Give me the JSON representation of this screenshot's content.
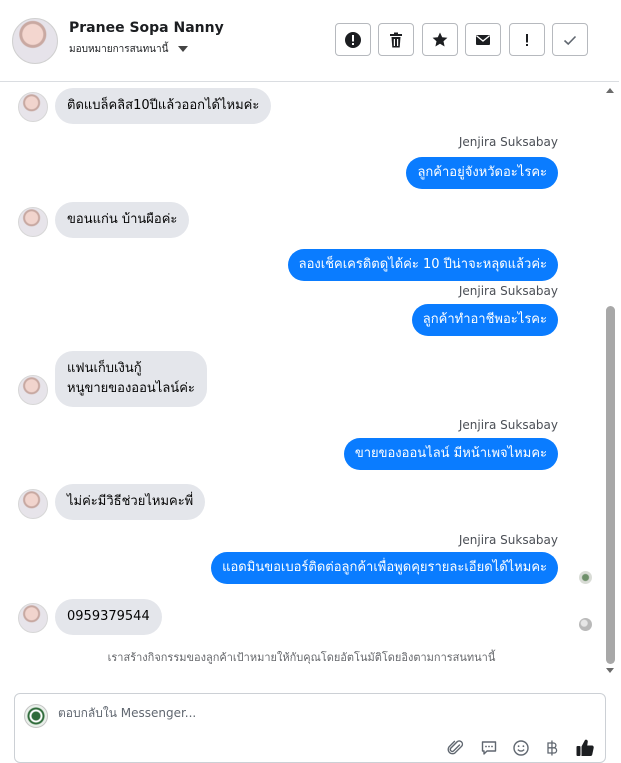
{
  "header": {
    "contact_name": "Pranee Sopa Nanny",
    "assign_label": "มอบหมายการสนทนานี้",
    "actions": [
      {
        "icon": "alert-circle-icon",
        "name": "mark-spam-button"
      },
      {
        "icon": "trash-icon",
        "name": "delete-button"
      },
      {
        "icon": "star-icon",
        "name": "star-button"
      },
      {
        "icon": "envelope-icon",
        "name": "mark-unread-button"
      },
      {
        "icon": "exclamation-icon",
        "name": "follow-up-button"
      },
      {
        "icon": "check-icon",
        "name": "mark-done-button"
      }
    ]
  },
  "thread": {
    "messages": [
      {
        "direction": "in",
        "text": "ติดแบล็คลิส10ปีแล้วออกได้ไหมค่ะ"
      },
      {
        "direction": "out",
        "sender": "Jenjira Suksabay",
        "text": "ลูกค้าอยู่จังหวัดอะไรคะ"
      },
      {
        "direction": "in",
        "text": "ขอนแก่น บ้านผือค่ะ"
      },
      {
        "direction": "out",
        "text": "ลองเช็คเครดิตดูได้ค่ะ 10 ปีน่าจะหลุดแล้วค่ะ"
      },
      {
        "direction": "out",
        "sender": "Jenjira Suksabay",
        "text": "ลูกค้าทำอาชีพอะไรคะ"
      },
      {
        "direction": "in",
        "lines": [
          "แฟนเก็บเงินกู้",
          "หนูขายของออนไลน์ค่ะ"
        ]
      },
      {
        "direction": "out",
        "sender": "Jenjira Suksabay",
        "text": "ขายของออนไลน์ มีหน้าเพจไหมคะ"
      },
      {
        "direction": "in",
        "text": "ไม่ค่ะมีวิธีช่วยไหมคะพี่"
      },
      {
        "direction": "out",
        "sender": "Jenjira Suksabay",
        "text": "แอดมินขอเบอร์ติดต่อลูกค้าเพื่อพูดคุยรายละเอียดได้ไหมคะ"
      },
      {
        "direction": "in",
        "text": "0959379544"
      }
    ],
    "system_note": "เราสร้างกิจกรรมของลูกค้าเป้าหมายให้กับคุณโดยอัตโนมัติโดยอิงตามการสนทนานี้"
  },
  "composer": {
    "placeholder": "ตอบกลับใน Messenger...",
    "tools": [
      "paperclip-icon",
      "saved-reply-icon",
      "emoji-icon",
      "baht-icon",
      "thumbs-up-icon"
    ]
  }
}
